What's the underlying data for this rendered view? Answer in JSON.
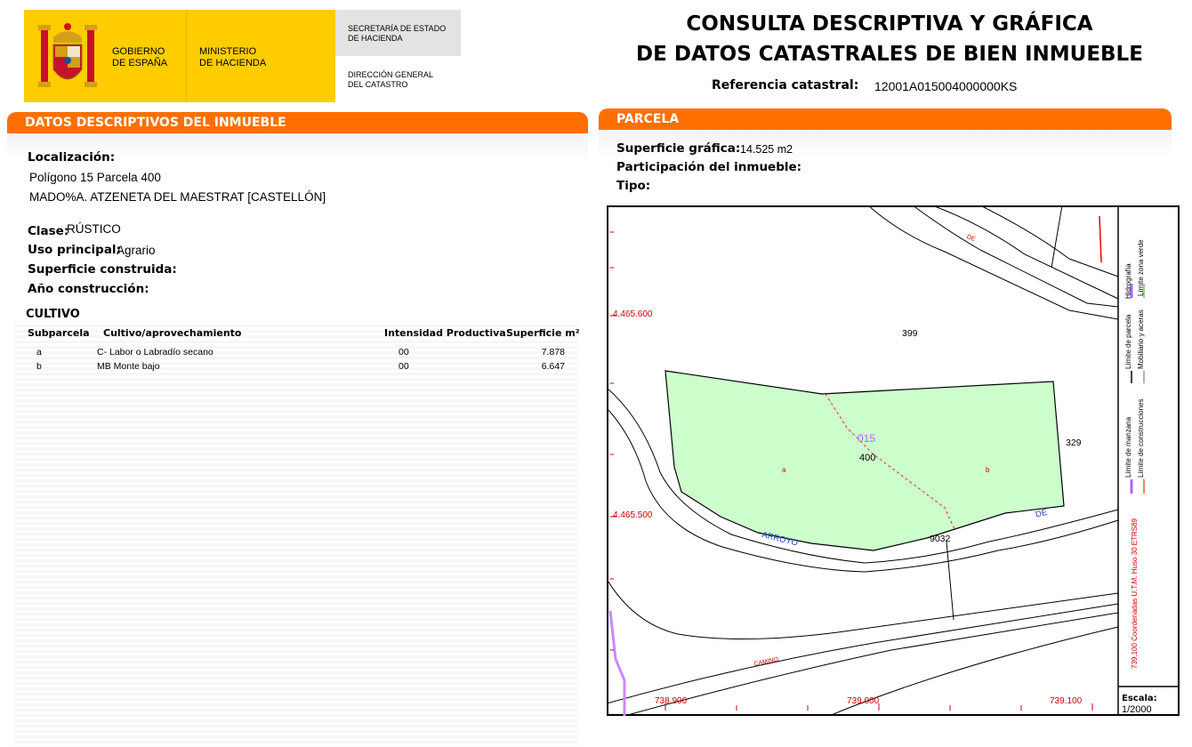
{
  "header": {
    "gov_line1": "GOBIERNO",
    "gov_line2": "DE ESPAÑA",
    "ministry_line1": "MINISTERIO",
    "ministry_line2": "DE HACIENDA",
    "secretaria_line1": "SECRETARÍA DE ESTADO",
    "secretaria_line2": "DE HACIENDA",
    "direccion_line1": "DIRECCIÓN GENERAL",
    "direccion_line2": "DEL CATASTRO",
    "title_line1": "CONSULTA DESCRIPTIVA Y GRÁFICA",
    "title_line2": "DE DATOS CATASTRALES DE BIEN INMUEBLE",
    "ref_label": "Referencia catastral:",
    "ref_value": "12001A015004000000KS"
  },
  "colors": {
    "brand_yellow": "#ffcc00",
    "section_orange": "#ff6f00",
    "parcel_fill": "#ccffcc",
    "coord_red": "#cc0000"
  },
  "descriptivos": {
    "title": "DATOS DESCRIPTIVOS DEL INMUEBLE",
    "localizacion_label": "Localización:",
    "localizacion_line1": "Polígono 15 Parcela 400",
    "localizacion_line2": "MADO%A. ATZENETA DEL MAESTRAT [CASTELLÓN]",
    "clase_label": "Clase:",
    "clase_value": "RÚSTICO",
    "uso_label": "Uso principal:",
    "uso_value": "Agrario",
    "superficie_label": "Superficie construida:",
    "anio_label": "Año construcción:",
    "cultivo_title": "CULTIVO",
    "columns": [
      "Subparcela",
      "Cultivo/aprovechamiento",
      "Intensidad Productiva",
      "Superficie m²"
    ],
    "rows": [
      {
        "sub": "a",
        "cultivo": "C- Labor o Labradío secano",
        "intensidad": "00",
        "superficie": "7.878"
      },
      {
        "sub": "b",
        "cultivo": "MB Monte bajo",
        "intensidad": "00",
        "superficie": "6.647"
      }
    ]
  },
  "parcela": {
    "title": "PARCELA",
    "superficie_label": "Superficie gráfica:",
    "superficie_value": "14.525 m2",
    "participacion_label": "Participación del inmueble:",
    "tipo_label": "Tipo:"
  },
  "map": {
    "coord_y_top": "4.465.600",
    "coord_y_bottom": "4.465.500",
    "coord_x_1": "738.900",
    "coord_x_2": "739.000",
    "coord_x_3": "739.100",
    "parcel_399": "399",
    "parcel_329": "329",
    "parcel_400": "400",
    "poligono_015": "015",
    "parcel_9032": "9032",
    "sub_a": "a",
    "sub_b": "b",
    "label_arroyo": "ARROYO",
    "label_de": "DE",
    "label_de_top": "DE",
    "label_camino": "CAMINO",
    "legend_hidrografia": "Hidrografía",
    "legend_zona_verde": "Límite zona verde",
    "legend_parcela": "Límite de parcela",
    "legend_mobiliario": "Mobiliario y aceras",
    "legend_manzana": "Límite de manzana",
    "legend_construcciones": "Límite de construcciones",
    "legend_coords": "739,100 Coordenadas U.T.M. Huso 30 ETRS89",
    "escala_label": "Escala:",
    "escala_value": "1/2000"
  }
}
